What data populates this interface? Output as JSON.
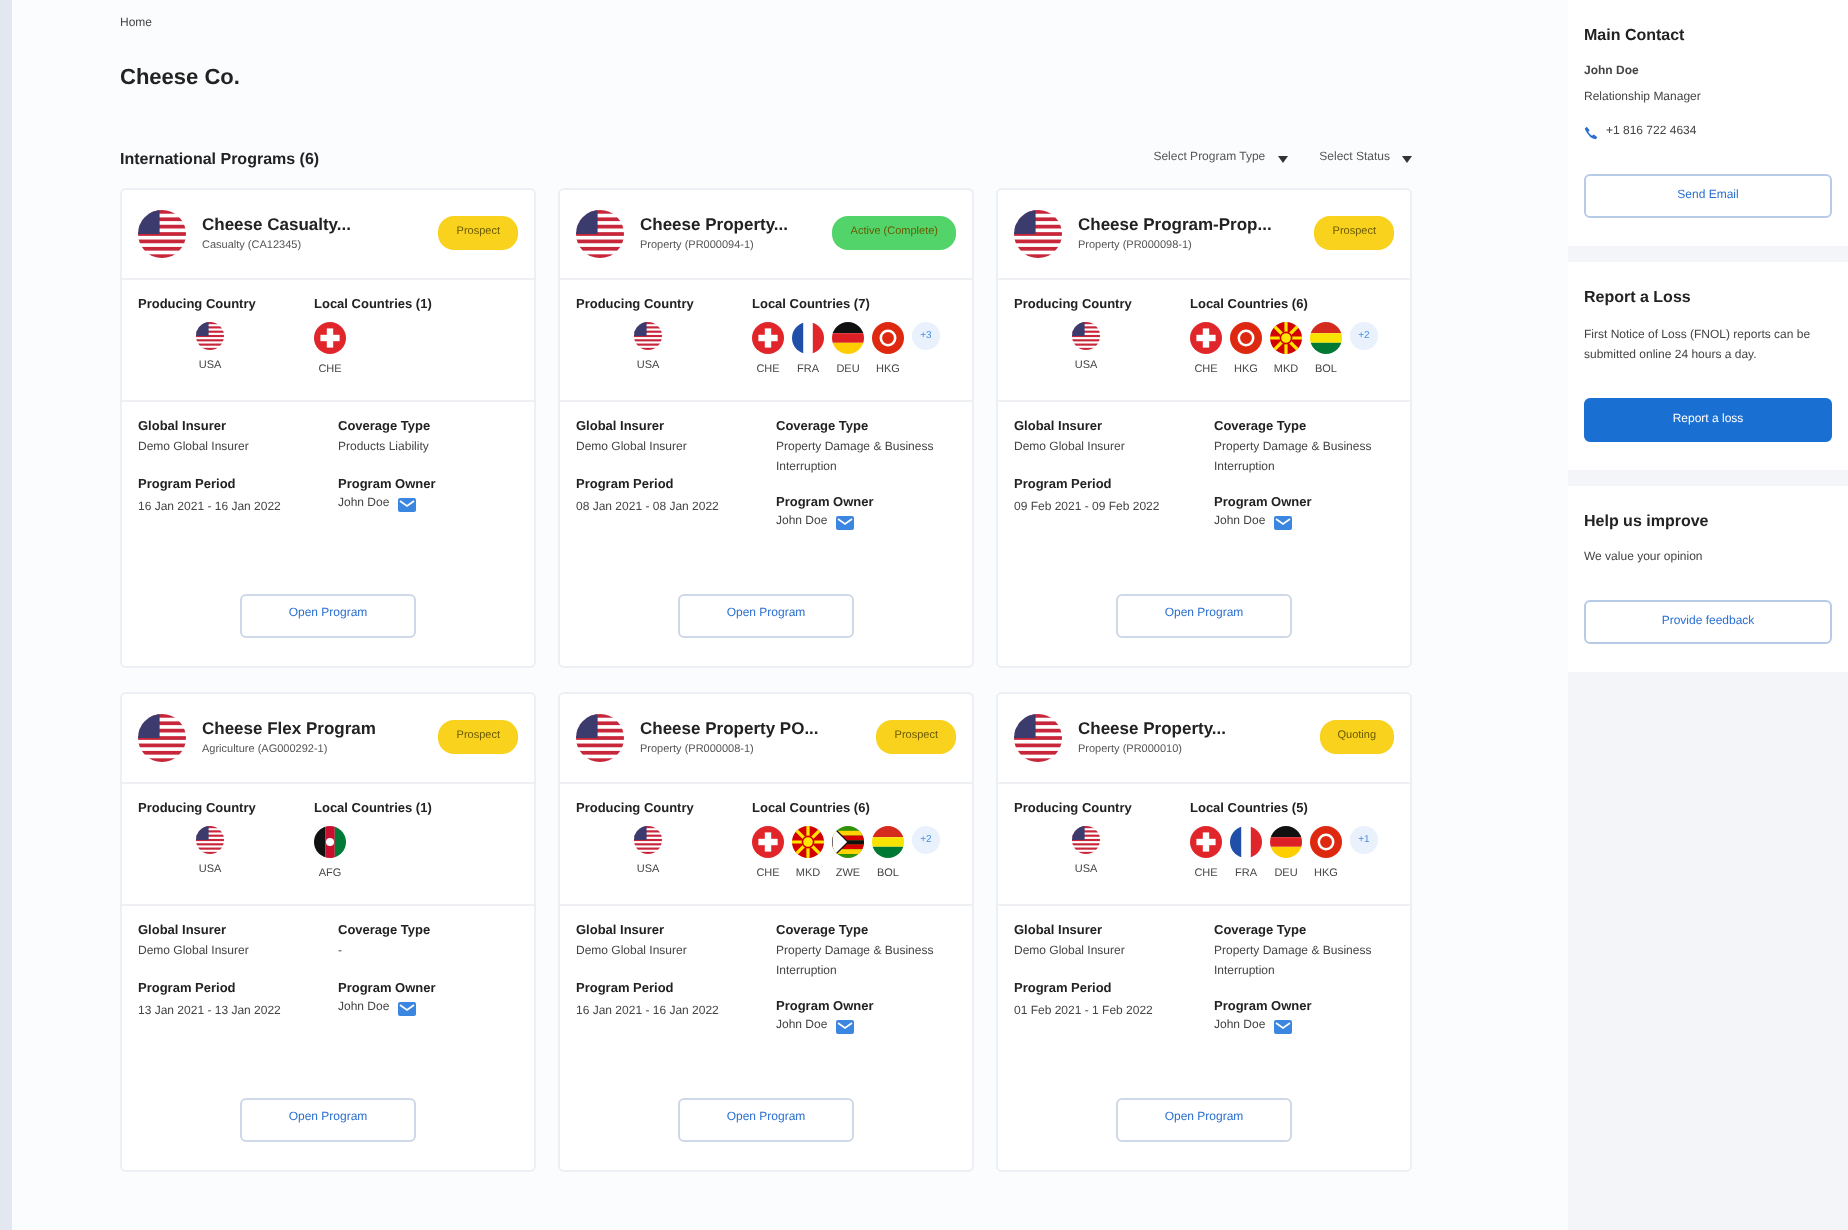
{
  "breadcrumb": "Home",
  "title": "Cheese Co.",
  "section": {
    "title": "International Programs (6)",
    "filters": [
      {
        "placeholder": "Select Program Type"
      },
      {
        "placeholder": "Select Status"
      }
    ]
  },
  "programs": [
    {
      "name": "Cheese Casualty...",
      "line": "Casualty (CA12345)",
      "status": {
        "text": "Prospect",
        "color": "#f8d21c"
      },
      "producing_label": "Producing Country",
      "producing": {
        "code": "USA",
        "kind": "usa"
      },
      "local_label": "Local Countries (1)",
      "local": [
        {
          "code": "CHE",
          "kind": "che"
        }
      ],
      "left": [
        {
          "label": "Global Insurer",
          "value": "Demo Global Insurer"
        },
        {
          "label": "Program Period",
          "value": "16 Jan 2021 - 16 Jan 2022"
        }
      ],
      "right": [
        {
          "label": "Coverage Type",
          "value": "Products Liability",
          "kind": "text"
        },
        {
          "label": "Program Owner",
          "value": "John Doe",
          "kind": "owner"
        }
      ],
      "button": "Open Program"
    },
    {
      "name": "Cheese Property...",
      "line": "Property (PR000094-1)",
      "status": {
        "text": "Active (Complete)",
        "color": "#52d46a"
      },
      "producing_label": "Producing Country",
      "producing": {
        "code": "USA",
        "kind": "usa"
      },
      "local_label": "Local Countries (7)",
      "local": [
        {
          "code": "CHE",
          "kind": "che"
        },
        {
          "code": "FRA",
          "kind": "fra"
        },
        {
          "code": "DEU",
          "kind": "deu"
        },
        {
          "code": "HKG",
          "kind": "hkg"
        }
      ],
      "more": "+3",
      "left": [
        {
          "label": "Global Insurer",
          "value": "Demo Global Insurer"
        },
        {
          "label": "Program Period",
          "value": "08 Jan 2021 - 08 Jan 2022"
        }
      ],
      "right": [
        {
          "label": "Coverage Type",
          "value": "Property Damage & Business Interruption",
          "kind": "text"
        },
        {
          "label": "Program Owner",
          "value": "John Doe",
          "kind": "owner"
        }
      ],
      "button": "Open Program"
    },
    {
      "name": "Cheese Program-Prop...",
      "line": "Property (PR000098-1)",
      "status": {
        "text": "Prospect",
        "color": "#f8d21c"
      },
      "producing_label": "Producing Country",
      "producing": {
        "code": "USA",
        "kind": "usa"
      },
      "local_label": "Local Countries (6)",
      "local": [
        {
          "code": "CHE",
          "kind": "che"
        },
        {
          "code": "HKG",
          "kind": "hkg"
        },
        {
          "code": "MKD",
          "kind": "mkd"
        },
        {
          "code": "BOL",
          "kind": "bol"
        }
      ],
      "more": "+2",
      "left": [
        {
          "label": "Global Insurer",
          "value": "Demo Global Insurer"
        },
        {
          "label": "Program Period",
          "value": "09 Feb 2021 - 09 Feb 2022"
        }
      ],
      "right": [
        {
          "label": "Coverage Type",
          "value": "Property Damage & Business Interruption",
          "kind": "text"
        },
        {
          "label": "Program Owner",
          "value": "John Doe",
          "kind": "owner"
        }
      ],
      "button": "Open Program"
    },
    {
      "name": "Cheese Flex Program",
      "line": "Agriculture (AG000292-1)",
      "status": {
        "text": "Prospect",
        "color": "#f8d21c"
      },
      "producing_label": "Producing Country",
      "producing": {
        "code": "USA",
        "kind": "usa"
      },
      "local_label": "Local Countries (1)",
      "local": [
        {
          "code": "AFG",
          "kind": "afg"
        }
      ],
      "left": [
        {
          "label": "Global Insurer",
          "value": "Demo Global Insurer"
        },
        {
          "label": "Program Period",
          "value": "13 Jan 2021 - 13 Jan 2022"
        }
      ],
      "right": [
        {
          "label": "Coverage Type",
          "value": "-",
          "kind": "text"
        },
        {
          "label": "Program Owner",
          "value": "John Doe",
          "kind": "owner"
        }
      ],
      "button": "Open Program"
    },
    {
      "name": "Cheese Property PO...",
      "line": "Property (PR000008-1)",
      "status": {
        "text": "Prospect",
        "color": "#f8d21c"
      },
      "producing_label": "Producing Country",
      "producing": {
        "code": "USA",
        "kind": "usa"
      },
      "local_label": "Local Countries (6)",
      "local": [
        {
          "code": "CHE",
          "kind": "che"
        },
        {
          "code": "MKD",
          "kind": "mkd"
        },
        {
          "code": "ZWE",
          "kind": "zwe"
        },
        {
          "code": "BOL",
          "kind": "bol"
        }
      ],
      "more": "+2",
      "left": [
        {
          "label": "Global Insurer",
          "value": "Demo Global Insurer"
        },
        {
          "label": "Program Period",
          "value": "16 Jan 2021 - 16 Jan 2022"
        }
      ],
      "right": [
        {
          "label": "Coverage Type",
          "value": "Property Damage & Business Interruption",
          "kind": "text"
        },
        {
          "label": "Program Owner",
          "value": "John Doe",
          "kind": "owner"
        }
      ],
      "button": "Open Program"
    },
    {
      "name": "Cheese Property...",
      "line": "Property (PR000010)",
      "status": {
        "text": "Quoting",
        "color": "#f8d21c"
      },
      "producing_label": "Producing Country",
      "producing": {
        "code": "USA",
        "kind": "usa"
      },
      "local_label": "Local Countries (5)",
      "local": [
        {
          "code": "CHE",
          "kind": "che"
        },
        {
          "code": "FRA",
          "kind": "fra"
        },
        {
          "code": "DEU",
          "kind": "deu"
        },
        {
          "code": "HKG",
          "kind": "hkg"
        }
      ],
      "more": "+1",
      "left": [
        {
          "label": "Global Insurer",
          "value": "Demo Global Insurer"
        },
        {
          "label": "Program Period",
          "value": "01 Feb 2021 - 1 Feb 2022"
        }
      ],
      "right": [
        {
          "label": "Coverage Type",
          "value": "Property Damage & Business Interruption",
          "kind": "text"
        },
        {
          "label": "Program Owner",
          "value": "John Doe",
          "kind": "owner"
        }
      ],
      "button": "Open Program"
    }
  ],
  "sidebar": [
    {
      "kind": "contact",
      "title": "Main Contact",
      "name": "John Doe",
      "role": "Relationship Manager",
      "phone": "+1 816 722 4634",
      "button": "Send Email"
    },
    {
      "kind": "report",
      "title": "Report a Loss",
      "text": "First Notice of Loss (FNOL) reports can be submitted online 24 hours a day.",
      "button": "Report a loss"
    },
    {
      "kind": "feedback",
      "title": "Help us improve",
      "text": "We value your opinion",
      "button": "Provide feedback"
    }
  ]
}
